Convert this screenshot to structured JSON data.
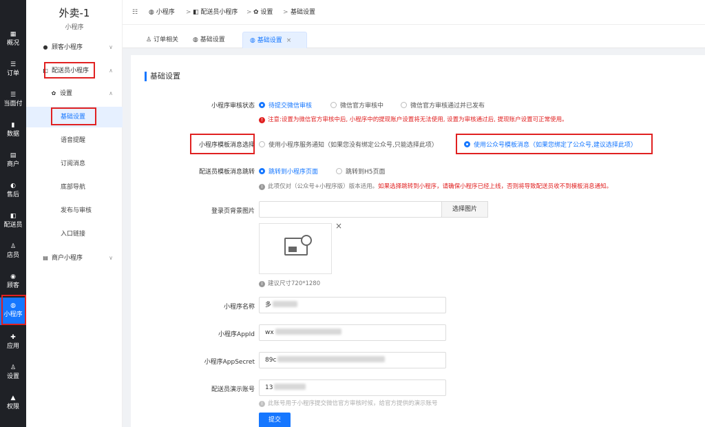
{
  "rail": {
    "items": [
      {
        "icon": "▦",
        "label": "概况"
      },
      {
        "icon": "☰",
        "label": "订单"
      },
      {
        "icon": "☰",
        "label": "当面付"
      },
      {
        "icon": "▮",
        "label": "数据"
      },
      {
        "icon": "▤",
        "label": "商户"
      },
      {
        "icon": "◐",
        "label": "售后"
      },
      {
        "icon": "◧",
        "label": "配送员"
      },
      {
        "icon": "♙",
        "label": "店员"
      },
      {
        "icon": "◉",
        "label": "顾客"
      },
      {
        "icon": "◍",
        "label": "小程序"
      },
      {
        "icon": "✚",
        "label": "应用"
      },
      {
        "icon": "♙",
        "label": "设置"
      },
      {
        "icon": "▲",
        "label": "权限"
      }
    ]
  },
  "sidebar": {
    "title": "外卖-1",
    "subtitle": "小程序",
    "groups": [
      {
        "label": "顾客小程序"
      },
      {
        "label": "配送员小程序"
      },
      {
        "label": "设置"
      },
      {
        "label": "商户小程序"
      }
    ],
    "subitems": [
      "基础设置",
      "语音提醒",
      "订阅消息",
      "底部导航",
      "发布与审核",
      "入口链接"
    ]
  },
  "breadcrumb": {
    "items": [
      "小程序",
      "配送员小程序",
      "设置",
      "基础设置"
    ],
    "sep": ">"
  },
  "tabs": [
    {
      "label": "订单相关"
    },
    {
      "label": "基础设置"
    },
    {
      "label": "基础设置"
    }
  ],
  "form": {
    "section_title": "基础设置",
    "review_status": {
      "label": "小程序审核状态",
      "options": [
        "待提交微信审核",
        "微信官方审核中",
        "微信官方审核通过并已发布"
      ],
      "note": "注意:设置为微信官方审核中后, 小程序中的提现账户设置将无法使用, 设置为审核通过后, 提现账户设置可正常使用。"
    },
    "template_msg": {
      "label": "小程序模板消息选择",
      "options": [
        "使用小程序服务通知（如果您没有绑定公众号,只能选择此项）",
        "使用公众号模板消息（如果您绑定了公众号,建议选择此项）"
      ]
    },
    "courier_jump": {
      "label": "配送员模板消息跳转",
      "options": [
        "跳转到小程序页面",
        "跳转到H5页面"
      ],
      "note_plain": "此项仅对（公众号+小程序版）版本适用。",
      "note_red": "如果选择跳转到小程序，请确保小程序已经上线，否则将导致配送员收不到模板消息通知。"
    },
    "login_bg": {
      "label": "登录页背景图片",
      "button": "选择图片",
      "remove": "×",
      "size_hint": "建议尺寸720*1280"
    },
    "app_name": {
      "label": "小程序名称",
      "value": "多"
    },
    "app_id": {
      "label": "小程序AppId",
      "value": "wx"
    },
    "app_secret": {
      "label": "小程序AppSecret",
      "value": "89c"
    },
    "demo_account": {
      "label": "配送员演示账号",
      "value": "13",
      "note": "此账号用于小程序提交微信官方审核时候，给官方提供的演示账号"
    },
    "submit": "提交"
  },
  "colors": {
    "accent": "#1677ff",
    "warn": "#e02020",
    "rail": "#1f2126"
  }
}
